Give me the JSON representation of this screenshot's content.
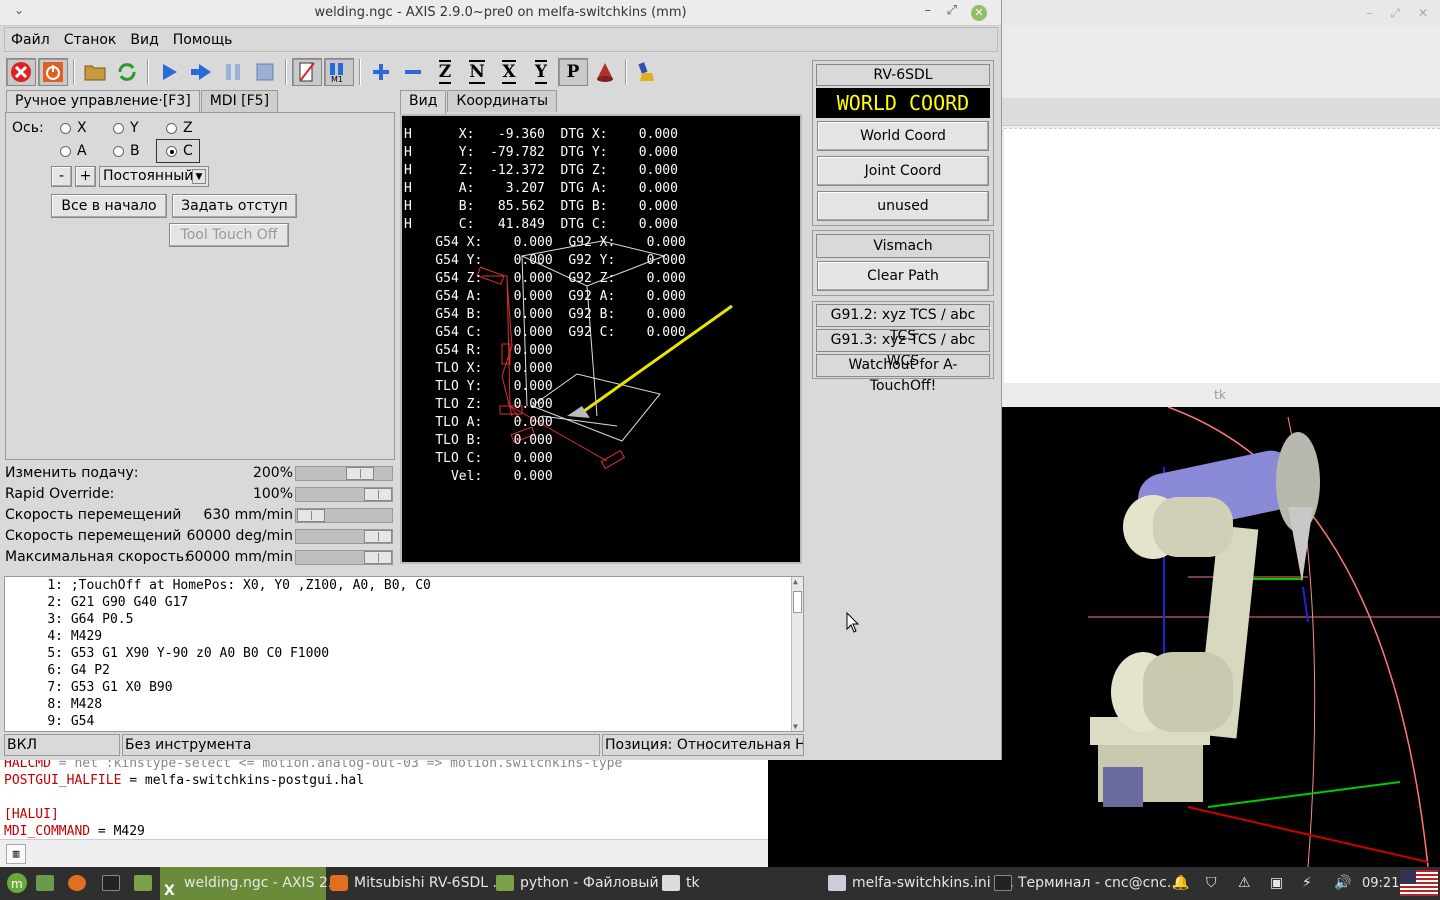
{
  "window": {
    "title": "welding.ngc - AXIS 2.9.0~pre0 on melfa-switchkins (mm)",
    "menu_arrow": "⌄",
    "minimize": "–",
    "restore": "⤢",
    "close": "✕"
  },
  "menu": [
    "Файл",
    "Станок",
    "Вид",
    "Помощь"
  ],
  "toolbar": {
    "letters": [
      "Z",
      "N",
      "X",
      "Y",
      "P"
    ]
  },
  "left_tabs": [
    "Ручное управление·[F3]",
    "MDI [F5]"
  ],
  "manual": {
    "axis_label": "Ось:",
    "axes": [
      "X",
      "Y",
      "Z",
      "A",
      "B",
      "C"
    ],
    "selected_axis": "C",
    "minus": "-",
    "plus": "+",
    "jog_mode": "Постоянный",
    "home_all": "Все в начало",
    "set_offset": "Задать отступ",
    "tool_touch_off": "Tool Touch Off"
  },
  "overrides": [
    {
      "label": "Изменить подачу:",
      "value": "200%",
      "fraction": 0.74
    },
    {
      "label": "Rapid Override:",
      "value": "100%",
      "fraction": 1.0
    },
    {
      "label": "Скорость перемещений",
      "value": "630 mm/min",
      "fraction": 0.02
    },
    {
      "label": "Скорость перемещений",
      "value": "60000 deg/min",
      "fraction": 1.0
    },
    {
      "label": "Максимальная скорость:",
      "value": "60000 mm/min",
      "fraction": 1.0
    }
  ],
  "right_tabs": [
    "Вид",
    "Координаты"
  ],
  "dro_lines": [
    "H      X:   -9.360  DTG X:    0.000",
    "H      Y:  -79.782  DTG Y:    0.000",
    "H      Z:  -12.372  DTG Z:    0.000",
    "H      A:    3.207  DTG A:    0.000",
    "H      B:   85.562  DTG B:    0.000",
    "H      C:   41.849  DTG C:    0.000",
    "    G54 X:    0.000  G92 X:    0.000",
    "    G54 Y:    0.000  G92 Y:    0.000",
    "    G54 Z:    0.000  G92 Z:    0.000",
    "    G54 A:    0.000  G92 A:    0.000",
    "    G54 B:    0.000  G92 B:    0.000",
    "    G54 C:    0.000  G92 C:    0.000",
    "    G54 R:    0.000",
    "    TLO X:    0.000",
    "    TLO Y:    0.000",
    "    TLO Z:    0.000",
    "    TLO A:    0.000",
    "    TLO B:    0.000",
    "    TLO C:    0.000",
    "      Vel:    0.000"
  ],
  "gcode": [
    {
      "n": "1:",
      "text": ";TouchOff at HomePos: X0, Y0 ,Z100, A0, B0, C0"
    },
    {
      "n": "2:",
      "text": "G21 G90 G40 G17"
    },
    {
      "n": "3:",
      "text": "G64 P0.5"
    },
    {
      "n": "4:",
      "text": "M429"
    },
    {
      "n": "5:",
      "text": "G53 G1 X90 Y-90 z0 A0 B0 C0 F1000"
    },
    {
      "n": "6:",
      "text": "G4 P2"
    },
    {
      "n": "7:",
      "text": "G53 G1 X0 B90"
    },
    {
      "n": "8:",
      "text": "M428"
    },
    {
      "n": "9:",
      "text": "G54"
    }
  ],
  "status": {
    "machine": "ВКЛ",
    "tool": "Без инструмента",
    "position": "Позиция: Относительная Нас"
  },
  "side_panel": {
    "robot": "RV-6SDL",
    "mode_display": "WORLD COORD",
    "world_coord": "World Coord",
    "joint_coord": "Joint Coord",
    "unused": "unused",
    "vismach": "Vismach",
    "clear_path": "Clear Path",
    "g91_2": "G91.2: xyz TCS / abc TCS",
    "g91_3": "G91.3: xyz TCS / abc WCS",
    "watchout": "Watchout for A-TouchOff!"
  },
  "tk_window": {
    "title": "tk"
  },
  "editor": {
    "line1_key": "HALCMD",
    "line1_rest": " = net :kinstype-select <= motion.analog-out-03 => motion.switchkins-type",
    "line2_key": "POSTGUI_HALFILE",
    "line2_rest": " = melfa-switchkins-postgui.hal",
    "line3": "[HALUI]",
    "line4_key": "MDI_COMMAND",
    "line4_rest": " = M429"
  },
  "taskbar": {
    "items": [
      "welding.ngc - AXIS 2...",
      "Mitsubishi RV-6SDL ...",
      "python - Файловый ...",
      "tk",
      "melfa-switchkins.ini (...",
      "Терминал - cnc@cnc..."
    ],
    "clock": "09:21"
  },
  "colors": {
    "dro_text": "#ffffff",
    "mode_display_text": "#ffff00",
    "editor_key": "#c00000",
    "taskbar_active": "#6a8c3a"
  }
}
